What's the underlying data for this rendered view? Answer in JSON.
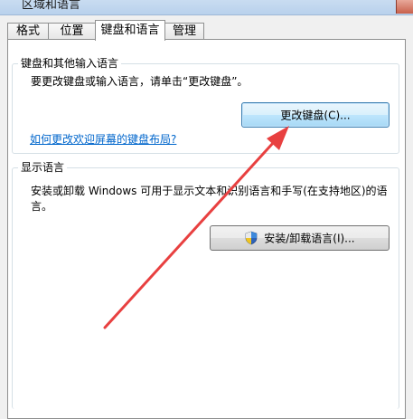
{
  "window": {
    "title": "区域和语言"
  },
  "tabs": [
    {
      "label": "格式"
    },
    {
      "label": "位置"
    },
    {
      "label": "键盘和语言",
      "active": true
    },
    {
      "label": "管理"
    }
  ],
  "keyboard_group": {
    "legend": "键盘和其他输入语言",
    "description": "要更改键盘或输入语言，请单击“更改键盘”。",
    "change_button": "更改键盘(C)...",
    "welcome_link": "如何更改欢迎屏幕的键盘布局?"
  },
  "display_group": {
    "legend": "显示语言",
    "description_line1": "安装或卸载 Windows 可用于显示文本和识别语言和手写(在支持地区)的语",
    "description_line2": "言。",
    "install_button": "安装/卸载语言(I)...",
    "install_icon": "uac-shield-icon"
  },
  "colors": {
    "link": "#0066cc",
    "annotation_arrow": "#e84040",
    "focus_border": "#3c7fb1"
  }
}
